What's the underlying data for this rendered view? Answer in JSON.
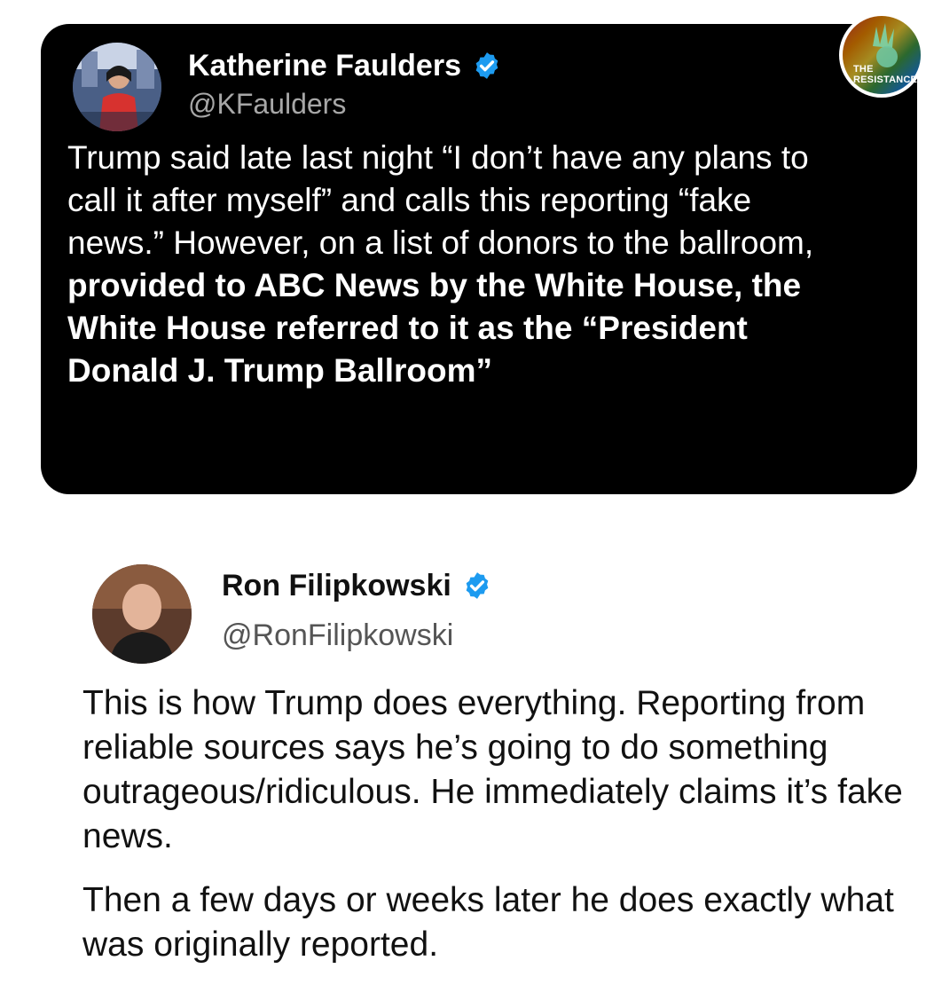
{
  "tweet1": {
    "author_name": "Katherine Faulders",
    "handle": "@KFaulders",
    "body_plain": "Trump said late last night “I don’t have any plans to call it after myself” and calls this reporting “fake news.” However, on a list of donors to the ballroom, ",
    "body_bold": "provided to ABC News by the White House, the White House referred to it as the “President Donald J. Trump Ballroom”",
    "verified_icon": "verified-badge-icon"
  },
  "badge": {
    "line1": "THE",
    "line2": "RESISTANCE"
  },
  "tweet2": {
    "author_name": "Ron Filipkowski",
    "handle": "@RonFilipkowski",
    "paragraph1": "This is how Trump does everything. Reporting from reliable sources says he’s going to do something outrageous/ridiculous. He immediately claims it’s fake news.",
    "paragraph2": "Then a few days or weeks later he does exactly what was originally reported.",
    "verified_icon": "verified-badge-icon"
  },
  "colors": {
    "dark_card": "#000000",
    "verified_blue": "#1d9bf0",
    "handle_gray_dark": "#a7a7a7",
    "handle_gray_light": "#555555"
  }
}
